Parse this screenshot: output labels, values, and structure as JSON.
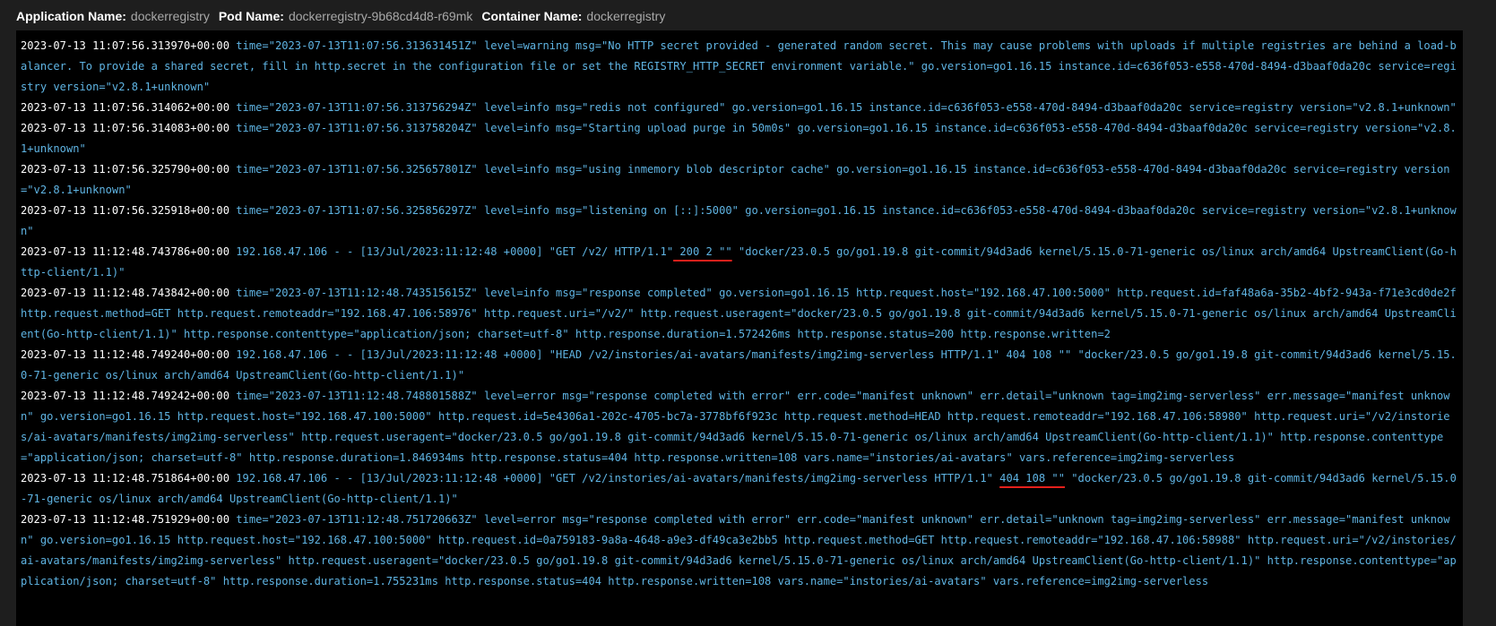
{
  "header": {
    "app_label": "Application Name:",
    "app_value": "dockerregistry",
    "pod_label": "Pod Name:",
    "pod_value": "dockerregistry-9b68cd4d8-r69mk",
    "container_label": "Container Name:",
    "container_value": "dockerregistry"
  },
  "colors": {
    "background": "#1e1e1e",
    "log_background": "#000000",
    "timestamp": "#ffffff",
    "message": "#5fb4e3",
    "annotation_underline": "#e5201b"
  },
  "log_lines": [
    {
      "ts": "2023-07-13 11:07:56.313970+00:00",
      "msg": "time=\"2023-07-13T11:07:56.313631451Z\" level=warning msg=\"No HTTP secret provided - generated random secret. This may cause problems with uploads if multiple registries are behind a load-balancer. To provide a shared secret, fill in http.secret in the configuration file or set the REGISTRY_HTTP_SECRET environment variable.\" go.version=go1.16.15 instance.id=c636f053-e558-470d-8494-d3baaf0da20c service=registry version=\"v2.8.1+unknown\""
    },
    {
      "ts": "2023-07-13 11:07:56.314062+00:00",
      "msg": "time=\"2023-07-13T11:07:56.313756294Z\" level=info msg=\"redis not configured\" go.version=go1.16.15 instance.id=c636f053-e558-470d-8494-d3baaf0da20c service=registry version=\"v2.8.1+unknown\""
    },
    {
      "ts": "2023-07-13 11:07:56.314083+00:00",
      "msg": "time=\"2023-07-13T11:07:56.313758204Z\" level=info msg=\"Starting upload purge in 50m0s\" go.version=go1.16.15 instance.id=c636f053-e558-470d-8494-d3baaf0da20c service=registry version=\"v2.8.1+unknown\""
    },
    {
      "ts": "2023-07-13 11:07:56.325790+00:00",
      "msg": "time=\"2023-07-13T11:07:56.325657801Z\" level=info msg=\"using inmemory blob descriptor cache\" go.version=go1.16.15 instance.id=c636f053-e558-470d-8494-d3baaf0da20c service=registry version=\"v2.8.1+unknown\""
    },
    {
      "ts": "2023-07-13 11:07:56.325918+00:00",
      "msg": "time=\"2023-07-13T11:07:56.325856297Z\" level=info msg=\"listening on [::]:5000\" go.version=go1.16.15 instance.id=c636f053-e558-470d-8494-d3baaf0da20c service=registry version=\"v2.8.1+unknown\""
    },
    {
      "ts": "2023-07-13 11:12:48.743786+00:00",
      "msg_before": "192.168.47.106 - - [13/Jul/2023:11:12:48 +0000] \"GET /v2/ HTTP/1.1\"",
      "msg_highlight": " 200 2 \"\"",
      "msg_after": " \"docker/23.0.5 go/go1.19.8 git-commit/94d3ad6 kernel/5.15.0-71-generic os/linux arch/amd64 UpstreamClient(Go-http-client/1.1)\""
    },
    {
      "ts": "2023-07-13 11:12:48.743842+00:00",
      "msg": "time=\"2023-07-13T11:12:48.743515615Z\" level=info msg=\"response completed\" go.version=go1.16.15 http.request.host=\"192.168.47.100:5000\" http.request.id=faf48a6a-35b2-4bf2-943a-f71e3cd0de2f http.request.method=GET http.request.remoteaddr=\"192.168.47.106:58976\" http.request.uri=\"/v2/\" http.request.useragent=\"docker/23.0.5 go/go1.19.8 git-commit/94d3ad6 kernel/5.15.0-71-generic os/linux arch/amd64 UpstreamClient(Go-http-client/1.1)\" http.response.contenttype=\"application/json; charset=utf-8\" http.response.duration=1.572426ms http.response.status=200 http.response.written=2"
    },
    {
      "ts": "2023-07-13 11:12:48.749240+00:00",
      "msg": "192.168.47.106 - - [13/Jul/2023:11:12:48 +0000] \"HEAD /v2/instories/ai-avatars/manifests/img2img-serverless HTTP/1.1\" 404 108 \"\" \"docker/23.0.5 go/go1.19.8 git-commit/94d3ad6 kernel/5.15.0-71-generic os/linux arch/amd64 UpstreamClient(Go-http-client/1.1)\""
    },
    {
      "ts": "2023-07-13 11:12:48.749242+00:00",
      "msg": "time=\"2023-07-13T11:12:48.748801588Z\" level=error msg=\"response completed with error\" err.code=\"manifest unknown\" err.detail=\"unknown tag=img2img-serverless\" err.message=\"manifest unknown\" go.version=go1.16.15 http.request.host=\"192.168.47.100:5000\" http.request.id=5e4306a1-202c-4705-bc7a-3778bf6f923c http.request.method=HEAD http.request.remoteaddr=\"192.168.47.106:58980\" http.request.uri=\"/v2/instories/ai-avatars/manifests/img2img-serverless\" http.request.useragent=\"docker/23.0.5 go/go1.19.8 git-commit/94d3ad6 kernel/5.15.0-71-generic os/linux arch/amd64 UpstreamClient(Go-http-client/1.1)\" http.response.contenttype=\"application/json; charset=utf-8\" http.response.duration=1.846934ms http.response.status=404 http.response.written=108 vars.name=\"instories/ai-avatars\" vars.reference=img2img-serverless"
    },
    {
      "ts": "2023-07-13 11:12:48.751864+00:00",
      "msg_before": "192.168.47.106 - - [13/Jul/2023:11:12:48 +0000] \"GET /v2/instories/ai-avatars/manifests/img2img-serverless HTTP/1.1\" ",
      "msg_highlight": "404 108 \"\"",
      "msg_after": " \"docker/23.0.5 go/go1.19.8 git-commit/94d3ad6 kernel/5.15.0-71-generic os/linux arch/amd64 UpstreamClient(Go-http-client/1.1)\""
    },
    {
      "ts": "2023-07-13 11:12:48.751929+00:00",
      "msg": "time=\"2023-07-13T11:12:48.751720663Z\" level=error msg=\"response completed with error\" err.code=\"manifest unknown\" err.detail=\"unknown tag=img2img-serverless\" err.message=\"manifest unknown\" go.version=go1.16.15 http.request.host=\"192.168.47.100:5000\" http.request.id=0a759183-9a8a-4648-a9e3-df49ca3e2bb5 http.request.method=GET http.request.remoteaddr=\"192.168.47.106:58988\" http.request.uri=\"/v2/instories/ai-avatars/manifests/img2img-serverless\" http.request.useragent=\"docker/23.0.5 go/go1.19.8 git-commit/94d3ad6 kernel/5.15.0-71-generic os/linux arch/amd64 UpstreamClient(Go-http-client/1.1)\" http.response.contenttype=\"application/json; charset=utf-8\" http.response.duration=1.755231ms http.response.status=404 http.response.written=108 vars.name=\"instories/ai-avatars\" vars.reference=img2img-serverless"
    }
  ]
}
